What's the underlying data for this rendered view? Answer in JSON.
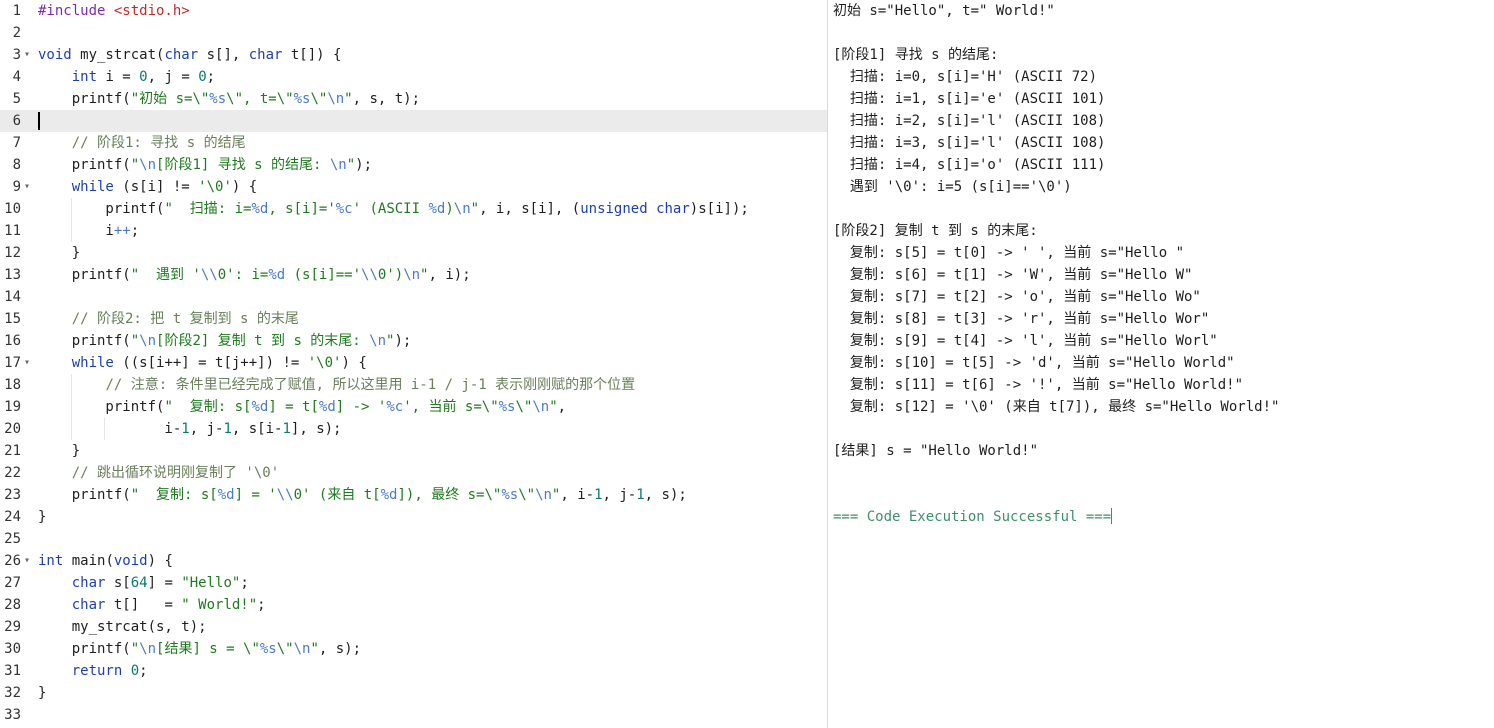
{
  "editor": {
    "active_line": 6,
    "lines": [
      {
        "n": "1",
        "fold": false,
        "indent": 0,
        "tokens": [
          [
            "pp",
            "#include "
          ],
          [
            "hdr",
            "<stdio.h>"
          ]
        ]
      },
      {
        "n": "2",
        "fold": false,
        "indent": 0,
        "tokens": []
      },
      {
        "n": "3",
        "fold": true,
        "indent": 0,
        "tokens": [
          [
            "kw",
            "void"
          ],
          [
            "op",
            " my_strcat("
          ],
          [
            "kw",
            "char"
          ],
          [
            "op",
            " s[], "
          ],
          [
            "kw",
            "char"
          ],
          [
            "op",
            " t[]) {"
          ]
        ]
      },
      {
        "n": "4",
        "fold": false,
        "indent": 1,
        "tokens": [
          [
            "op",
            "    "
          ],
          [
            "kw",
            "int"
          ],
          [
            "op",
            " i = "
          ],
          [
            "num",
            "0"
          ],
          [
            "op",
            ", j = "
          ],
          [
            "num",
            "0"
          ],
          [
            "op",
            ";"
          ]
        ]
      },
      {
        "n": "5",
        "fold": false,
        "indent": 1,
        "tokens": [
          [
            "op",
            "    printf("
          ],
          [
            "str",
            "\"初始 s=\\\""
          ],
          [
            "esc",
            "%s"
          ],
          [
            "str",
            "\\\", t=\\\""
          ],
          [
            "esc",
            "%s"
          ],
          [
            "str",
            "\\\""
          ],
          [
            "esc",
            "\\n"
          ],
          [
            "str",
            "\""
          ],
          [
            "op",
            ", s, t);"
          ]
        ]
      },
      {
        "n": "6",
        "fold": false,
        "indent": 0,
        "tokens": []
      },
      {
        "n": "7",
        "fold": false,
        "indent": 1,
        "tokens": [
          [
            "op",
            "    "
          ],
          [
            "cmt",
            "// 阶段1: 寻找 s 的结尾"
          ]
        ]
      },
      {
        "n": "8",
        "fold": false,
        "indent": 1,
        "tokens": [
          [
            "op",
            "    printf("
          ],
          [
            "str",
            "\""
          ],
          [
            "esc",
            "\\n"
          ],
          [
            "str",
            "[阶段1] 寻找 s 的结尾: "
          ],
          [
            "esc",
            "\\n"
          ],
          [
            "str",
            "\""
          ],
          [
            "op",
            ");"
          ]
        ]
      },
      {
        "n": "9",
        "fold": true,
        "indent": 1,
        "tokens": [
          [
            "op",
            "    "
          ],
          [
            "kw",
            "while"
          ],
          [
            "op",
            " (s[i] != "
          ],
          [
            "str",
            "'\\0'"
          ],
          [
            "op",
            ") {"
          ]
        ]
      },
      {
        "n": "10",
        "fold": false,
        "indent": 2,
        "tokens": [
          [
            "op",
            "        printf("
          ],
          [
            "str",
            "\"  扫描: i="
          ],
          [
            "esc",
            "%d"
          ],
          [
            "str",
            ", s[i]='"
          ],
          [
            "esc",
            "%c"
          ],
          [
            "str",
            "' (ASCII "
          ],
          [
            "esc",
            "%d"
          ],
          [
            "str",
            ")"
          ],
          [
            "esc",
            "\\n"
          ],
          [
            "str",
            "\""
          ],
          [
            "op",
            ", i, s[i], ("
          ],
          [
            "kw",
            "unsigned char"
          ],
          [
            "op",
            ")s[i]);"
          ]
        ]
      },
      {
        "n": "11",
        "fold": false,
        "indent": 2,
        "tokens": [
          [
            "op",
            "        i"
          ],
          [
            "esc",
            "++"
          ],
          [
            "op",
            ";"
          ]
        ]
      },
      {
        "n": "12",
        "fold": false,
        "indent": 1,
        "tokens": [
          [
            "op",
            "    }"
          ]
        ]
      },
      {
        "n": "13",
        "fold": false,
        "indent": 1,
        "tokens": [
          [
            "op",
            "    printf("
          ],
          [
            "str",
            "\"  遇到 '"
          ],
          [
            "esc",
            "\\\\"
          ],
          [
            "str",
            "0': i="
          ],
          [
            "esc",
            "%d"
          ],
          [
            "str",
            " (s[i]=='"
          ],
          [
            "esc",
            "\\\\"
          ],
          [
            "str",
            "0')"
          ],
          [
            "esc",
            "\\n"
          ],
          [
            "str",
            "\""
          ],
          [
            "op",
            ", i);"
          ]
        ]
      },
      {
        "n": "14",
        "fold": false,
        "indent": 1,
        "tokens": []
      },
      {
        "n": "15",
        "fold": false,
        "indent": 1,
        "tokens": [
          [
            "op",
            "    "
          ],
          [
            "cmt",
            "// 阶段2: 把 t 复制到 s 的末尾"
          ]
        ]
      },
      {
        "n": "16",
        "fold": false,
        "indent": 1,
        "tokens": [
          [
            "op",
            "    printf("
          ],
          [
            "str",
            "\""
          ],
          [
            "esc",
            "\\n"
          ],
          [
            "str",
            "[阶段2] 复制 t 到 s 的末尾: "
          ],
          [
            "esc",
            "\\n"
          ],
          [
            "str",
            "\""
          ],
          [
            "op",
            ");"
          ]
        ]
      },
      {
        "n": "17",
        "fold": true,
        "indent": 1,
        "tokens": [
          [
            "op",
            "    "
          ],
          [
            "kw",
            "while"
          ],
          [
            "op",
            " ((s[i++] = t[j++]) != "
          ],
          [
            "str",
            "'\\0'"
          ],
          [
            "op",
            ") {"
          ]
        ]
      },
      {
        "n": "18",
        "fold": false,
        "indent": 2,
        "tokens": [
          [
            "op",
            "        "
          ],
          [
            "cmt",
            "// 注意: 条件里已经完成了赋值, 所以这里用 i-1 / j-1 表示刚刚赋的那个位置"
          ]
        ]
      },
      {
        "n": "19",
        "fold": false,
        "indent": 2,
        "tokens": [
          [
            "op",
            "        printf("
          ],
          [
            "str",
            "\"  复制: s["
          ],
          [
            "esc",
            "%d"
          ],
          [
            "str",
            "] = t["
          ],
          [
            "esc",
            "%d"
          ],
          [
            "str",
            "] -> '"
          ],
          [
            "esc",
            "%c"
          ],
          [
            "str",
            "', 当前 s=\\\""
          ],
          [
            "esc",
            "%s"
          ],
          [
            "str",
            "\\\""
          ],
          [
            "esc",
            "\\n"
          ],
          [
            "str",
            "\""
          ],
          [
            "op",
            ","
          ]
        ]
      },
      {
        "n": "20",
        "fold": false,
        "indent": 3,
        "tokens": [
          [
            "op",
            "               i-"
          ],
          [
            "num",
            "1"
          ],
          [
            "op",
            ", j-"
          ],
          [
            "num",
            "1"
          ],
          [
            "op",
            ", s[i-"
          ],
          [
            "num",
            "1"
          ],
          [
            "op",
            "], s);"
          ]
        ]
      },
      {
        "n": "21",
        "fold": false,
        "indent": 1,
        "tokens": [
          [
            "op",
            "    }"
          ]
        ]
      },
      {
        "n": "22",
        "fold": false,
        "indent": 1,
        "tokens": [
          [
            "op",
            "    "
          ],
          [
            "cmt",
            "// 跳出循环说明刚复制了 '\\0'"
          ]
        ]
      },
      {
        "n": "23",
        "fold": false,
        "indent": 1,
        "tokens": [
          [
            "op",
            "    printf("
          ],
          [
            "str",
            "\"  复制: s["
          ],
          [
            "esc",
            "%d"
          ],
          [
            "str",
            "] = '"
          ],
          [
            "esc",
            "\\\\"
          ],
          [
            "str",
            "0' (来自 t["
          ],
          [
            "esc",
            "%d"
          ],
          [
            "str",
            "]), 最终 s=\\\""
          ],
          [
            "esc",
            "%s"
          ],
          [
            "str",
            "\\\""
          ],
          [
            "esc",
            "\\n"
          ],
          [
            "str",
            "\""
          ],
          [
            "op",
            ", i-"
          ],
          [
            "num",
            "1"
          ],
          [
            "op",
            ", j-"
          ],
          [
            "num",
            "1"
          ],
          [
            "op",
            ", s);"
          ]
        ]
      },
      {
        "n": "24",
        "fold": false,
        "indent": 0,
        "tokens": [
          [
            "op",
            "}"
          ]
        ]
      },
      {
        "n": "25",
        "fold": false,
        "indent": 0,
        "tokens": []
      },
      {
        "n": "26",
        "fold": true,
        "indent": 0,
        "tokens": [
          [
            "kw",
            "int"
          ],
          [
            "op",
            " main("
          ],
          [
            "kw",
            "void"
          ],
          [
            "op",
            ") {"
          ]
        ]
      },
      {
        "n": "27",
        "fold": false,
        "indent": 1,
        "tokens": [
          [
            "op",
            "    "
          ],
          [
            "kw",
            "char"
          ],
          [
            "op",
            " s["
          ],
          [
            "num",
            "64"
          ],
          [
            "op",
            "] = "
          ],
          [
            "str",
            "\"Hello\""
          ],
          [
            "op",
            ";"
          ]
        ]
      },
      {
        "n": "28",
        "fold": false,
        "indent": 1,
        "tokens": [
          [
            "op",
            "    "
          ],
          [
            "kw",
            "char"
          ],
          [
            "op",
            " t[]   = "
          ],
          [
            "str",
            "\" World!\""
          ],
          [
            "op",
            ";"
          ]
        ]
      },
      {
        "n": "29",
        "fold": false,
        "indent": 1,
        "tokens": [
          [
            "op",
            "    my_strcat(s, t);"
          ]
        ]
      },
      {
        "n": "30",
        "fold": false,
        "indent": 1,
        "tokens": [
          [
            "op",
            "    printf("
          ],
          [
            "str",
            "\""
          ],
          [
            "esc",
            "\\n"
          ],
          [
            "str",
            "[结果] s = \\\""
          ],
          [
            "esc",
            "%s"
          ],
          [
            "str",
            "\\\""
          ],
          [
            "esc",
            "\\n"
          ],
          [
            "str",
            "\""
          ],
          [
            "op",
            ", s);"
          ]
        ]
      },
      {
        "n": "31",
        "fold": false,
        "indent": 1,
        "tokens": [
          [
            "op",
            "    "
          ],
          [
            "kw",
            "return"
          ],
          [
            "op",
            " "
          ],
          [
            "num",
            "0"
          ],
          [
            "op",
            ";"
          ]
        ]
      },
      {
        "n": "32",
        "fold": false,
        "indent": 0,
        "tokens": [
          [
            "op",
            "}"
          ]
        ]
      },
      {
        "n": "33",
        "fold": false,
        "indent": 0,
        "tokens": []
      }
    ]
  },
  "output": {
    "lines": [
      "初始 s=\"Hello\", t=\" World!\"",
      "",
      "[阶段1] 寻找 s 的结尾:",
      "  扫描: i=0, s[i]='H' (ASCII 72)",
      "  扫描: i=1, s[i]='e' (ASCII 101)",
      "  扫描: i=2, s[i]='l' (ASCII 108)",
      "  扫描: i=3, s[i]='l' (ASCII 108)",
      "  扫描: i=4, s[i]='o' (ASCII 111)",
      "  遇到 '\\0': i=5 (s[i]=='\\0')",
      "",
      "[阶段2] 复制 t 到 s 的末尾:",
      "  复制: s[5] = t[0] -> ' ', 当前 s=\"Hello \"",
      "  复制: s[6] = t[1] -> 'W', 当前 s=\"Hello W\"",
      "  复制: s[7] = t[2] -> 'o', 当前 s=\"Hello Wo\"",
      "  复制: s[8] = t[3] -> 'r', 当前 s=\"Hello Wor\"",
      "  复制: s[9] = t[4] -> 'l', 当前 s=\"Hello Worl\"",
      "  复制: s[10] = t[5] -> 'd', 当前 s=\"Hello World\"",
      "  复制: s[11] = t[6] -> '!', 当前 s=\"Hello World!\"",
      "  复制: s[12] = '\\0' (来自 t[7]), 最终 s=\"Hello World!\"",
      "",
      "[结果] s = \"Hello World!\"",
      "",
      ""
    ],
    "status": "=== Code Execution Successful ==="
  }
}
